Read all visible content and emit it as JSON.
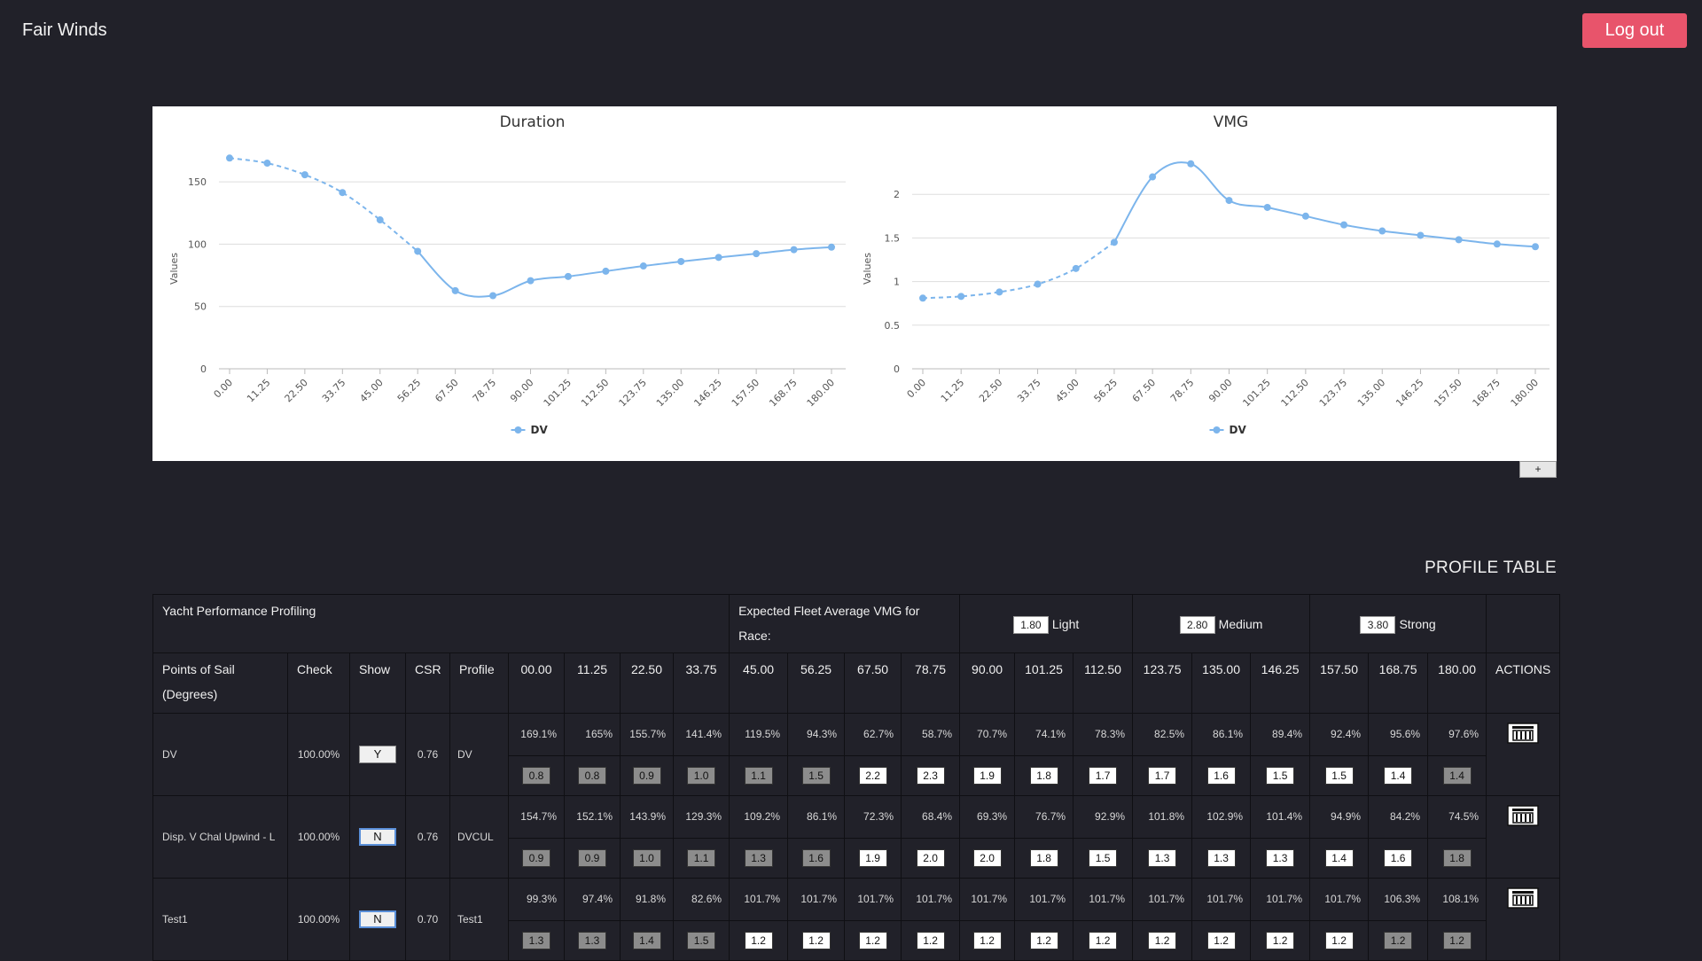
{
  "app": {
    "title": "Fair Winds",
    "logout_label": "Log out"
  },
  "charts_toggle_label": "+",
  "chart_data": [
    {
      "type": "line",
      "title": "Duration",
      "ylabel": "Values",
      "xlabel": "",
      "ylim": [
        0,
        175
      ],
      "yticks": [
        0,
        50,
        100,
        150
      ],
      "categories": [
        "0.00",
        "11.25",
        "22.50",
        "33.75",
        "45.00",
        "56.25",
        "67.50",
        "78.75",
        "90.00",
        "101.25",
        "112.50",
        "123.75",
        "135.00",
        "146.25",
        "157.50",
        "168.75",
        "180.00"
      ],
      "series": [
        {
          "name": "DV",
          "values": [
            169.1,
            165,
            155.7,
            141.4,
            119.5,
            94.3,
            62.7,
            58.7,
            70.7,
            74.1,
            78.3,
            82.5,
            86.1,
            89.4,
            92.4,
            95.6,
            97.6
          ],
          "dashed_until_index": 5
        }
      ],
      "legend": "bottom-center",
      "grid": true
    },
    {
      "type": "line",
      "title": "VMG",
      "ylabel": "Values",
      "xlabel": "",
      "ylim": [
        0,
        2.5
      ],
      "yticks": [
        0,
        0.5,
        1,
        1.5,
        2
      ],
      "categories": [
        "0.00",
        "11.25",
        "22.50",
        "33.75",
        "45.00",
        "56.25",
        "67.50",
        "78.75",
        "90.00",
        "101.25",
        "112.50",
        "123.75",
        "135.00",
        "146.25",
        "157.50",
        "168.75",
        "180.00"
      ],
      "series": [
        {
          "name": "DV",
          "values": [
            0.81,
            0.83,
            0.88,
            0.97,
            1.15,
            1.45,
            2.2,
            2.35,
            1.93,
            1.85,
            1.75,
            1.65,
            1.58,
            1.53,
            1.48,
            1.43,
            1.4
          ],
          "dashed_until_index": 5
        }
      ],
      "legend": "bottom-center",
      "grid": true
    }
  ],
  "profile_table": {
    "title": "PROFILE TABLE",
    "header1": {
      "performance": "Yacht Performance Profiling",
      "fleet_vmg": "Expected Fleet Average VMG for Race:",
      "winds": [
        {
          "value": "1.80",
          "label": "Light"
        },
        {
          "value": "2.80",
          "label": "Medium"
        },
        {
          "value": "3.80",
          "label": "Strong"
        }
      ]
    },
    "columns": {
      "points": "Points of Sail (Degrees)",
      "check": "Check",
      "show": "Show",
      "csr": "CSR",
      "profile": "Profile",
      "angles": [
        "00.00",
        "11.25",
        "22.50",
        "33.75",
        "45.00",
        "56.25",
        "67.50",
        "78.75",
        "90.00",
        "101.25",
        "112.50",
        "123.75",
        "135.00",
        "146.25",
        "157.50",
        "168.75",
        "180.00"
      ],
      "actions": "ACTIONS"
    },
    "rows": [
      {
        "name": "DV",
        "check": "100.00%",
        "show": "Y",
        "csr": "0.76",
        "profile": "DV",
        "pcts": [
          "169.1%",
          "165%",
          "155.7%",
          "141.4%",
          "119.5%",
          "94.3%",
          "62.7%",
          "58.7%",
          "70.7%",
          "74.1%",
          "78.3%",
          "82.5%",
          "86.1%",
          "89.4%",
          "92.4%",
          "95.6%",
          "97.6%"
        ],
        "boxes": [
          "0.8",
          "0.8",
          "0.9",
          "1.0",
          "1.1",
          "1.5",
          "2.2",
          "2.3",
          "1.9",
          "1.8",
          "1.7",
          "1.7",
          "1.6",
          "1.5",
          "1.5",
          "1.4",
          "1.4"
        ],
        "box_styles": [
          "g",
          "g",
          "g",
          "g",
          "g",
          "g",
          "w",
          "w",
          "w",
          "w",
          "w",
          "w",
          "w",
          "w",
          "w",
          "w",
          "g"
        ]
      },
      {
        "name": "Disp. V Chal Upwind - L",
        "check": "100.00%",
        "show": "N",
        "csr": "0.76",
        "profile": "DVCUL",
        "pcts": [
          "154.7%",
          "152.1%",
          "143.9%",
          "129.3%",
          "109.2%",
          "86.1%",
          "72.3%",
          "68.4%",
          "69.3%",
          "76.7%",
          "92.9%",
          "101.8%",
          "102.9%",
          "101.4%",
          "94.9%",
          "84.2%",
          "74.5%"
        ],
        "boxes": [
          "0.9",
          "0.9",
          "1.0",
          "1.1",
          "1.3",
          "1.6",
          "1.9",
          "2.0",
          "2.0",
          "1.8",
          "1.5",
          "1.3",
          "1.3",
          "1.3",
          "1.4",
          "1.6",
          "1.8"
        ],
        "box_styles": [
          "g",
          "g",
          "g",
          "g",
          "g",
          "g",
          "w",
          "w",
          "w",
          "w",
          "w",
          "w",
          "w",
          "w",
          "w",
          "w",
          "g"
        ]
      },
      {
        "name": "Test1",
        "check": "100.00%",
        "show": "N",
        "csr": "0.70",
        "profile": "Test1",
        "pcts": [
          "99.3%",
          "97.4%",
          "91.8%",
          "82.6%",
          "101.7%",
          "101.7%",
          "101.7%",
          "101.7%",
          "101.7%",
          "101.7%",
          "101.7%",
          "101.7%",
          "101.7%",
          "101.7%",
          "101.7%",
          "106.3%",
          "108.1%"
        ],
        "boxes": [
          "1.3",
          "1.3",
          "1.4",
          "1.5",
          "1.2",
          "1.2",
          "1.2",
          "1.2",
          "1.2",
          "1.2",
          "1.2",
          "1.2",
          "1.2",
          "1.2",
          "1.2",
          "1.2",
          "1.2"
        ],
        "box_styles": [
          "g",
          "g",
          "g",
          "g",
          "w",
          "w",
          "w",
          "w",
          "w",
          "w",
          "w",
          "w",
          "w",
          "w",
          "w",
          "g",
          "g"
        ]
      }
    ]
  }
}
